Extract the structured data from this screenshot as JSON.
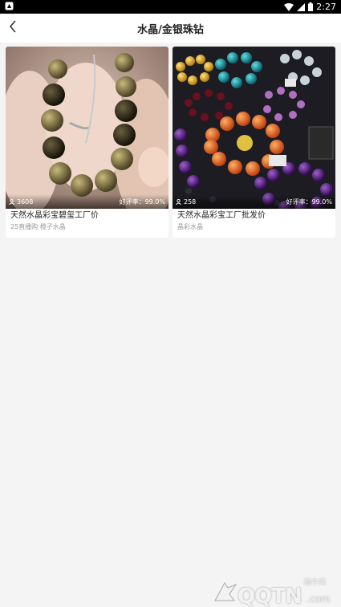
{
  "status_bar": {
    "time": "2:27"
  },
  "nav": {
    "title": "水晶/金银珠钻"
  },
  "products": [
    {
      "viewers": "3608",
      "rating": "好评率：99.0%",
      "name": "天然水晶彩宝碧玺工厂价",
      "shop": "25直播购·橙子水晶"
    },
    {
      "viewers": "258",
      "rating": "好评率：99.0%",
      "name": "天然水晶彩宝工厂批发价",
      "shop": "晶彩水晶"
    }
  ],
  "watermark": {
    "logo": "QQTN",
    "com": ".com",
    "cn": "腾牛网"
  },
  "colors": {
    "status_bar": "#000000",
    "page_bg": "#f4f4f4",
    "card_bg": "#ffffff",
    "muted_text": "#999999"
  },
  "icons": [
    "android-notification-icon",
    "wifi-icon",
    "signal-icon",
    "battery-icon",
    "back-arrow-icon",
    "viewer-person-icon"
  ]
}
